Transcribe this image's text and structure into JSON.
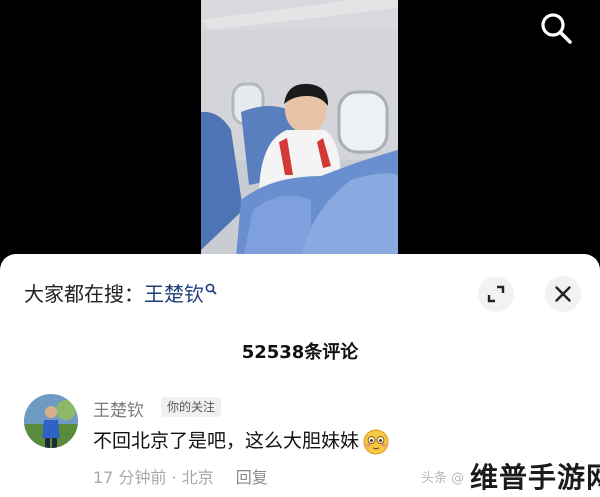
{
  "search_bar": {
    "prefix": "大家都在搜：",
    "keyword": "王楚钦"
  },
  "comments": {
    "count_label": "52538条评论",
    "items": [
      {
        "username": "王楚钦",
        "tag": "你的关注",
        "text": "不回北京了是吧，这么大胆妹妹",
        "emoji": "flushed-face-emoji",
        "time_location": "17 分钟前 · 北京",
        "reply_label": "回复"
      }
    ]
  },
  "watermarks": {
    "source_text": "头条 @",
    "brand": "维普手游网"
  },
  "icons": {
    "search": "search-icon",
    "expand": "expand-icon",
    "close": "close-icon"
  },
  "colors": {
    "keyword": "#1d3e7a",
    "sheet_bg": "#ffffff",
    "video_bg": "#000000"
  }
}
